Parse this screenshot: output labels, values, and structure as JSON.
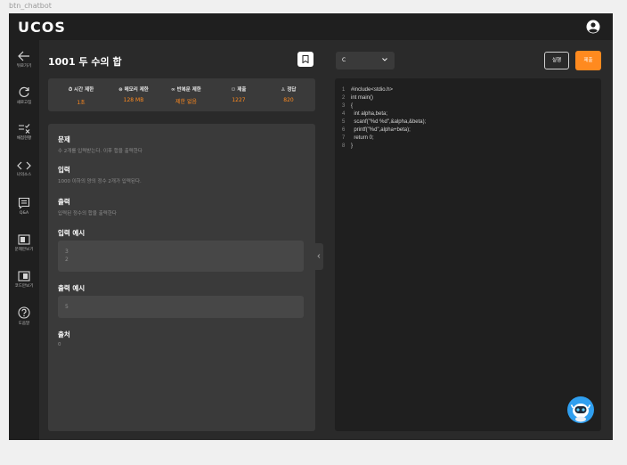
{
  "frame_label": "btn_chatbot",
  "app": {
    "logo": "UCOS"
  },
  "sidebar": {
    "items": [
      {
        "label": "뒤로가기",
        "icon": "arrow-left-icon"
      },
      {
        "label": "새로고침",
        "icon": "refresh-icon"
      },
      {
        "label": "채점현황",
        "icon": "grading-status-icon"
      },
      {
        "label": "나의소스",
        "icon": "code-brackets-icon"
      },
      {
        "label": "Q&A",
        "icon": "qa-icon"
      },
      {
        "label": "문제만보기",
        "icon": "problem-only-icon"
      },
      {
        "label": "코드만보기",
        "icon": "code-only-icon"
      },
      {
        "label": "도움말",
        "icon": "help-icon"
      }
    ]
  },
  "problem": {
    "title": "1001 두 수의 합",
    "stats": [
      {
        "label": "시간 제한",
        "value": "1초",
        "icon": "clock-icon"
      },
      {
        "label": "메모리 제한",
        "value": "128 MB",
        "icon": "memory-icon"
      },
      {
        "label": "반복문 제한",
        "value": "제한 없음",
        "icon": "infinity-icon"
      },
      {
        "label": "제출",
        "value": "1227",
        "icon": "users-icon"
      },
      {
        "label": "정답",
        "value": "820",
        "icon": "user-check-icon"
      }
    ],
    "sections": {
      "problem_head": "문제",
      "problem_text": "수 2개를 입력받는다. 이후 합을 출력한다",
      "input_head": "입력",
      "input_text": "1000 이하의 양의 정수 2개가 입력된다.",
      "output_head": "출력",
      "output_text": "입력된 정수의 합을 출력한다",
      "sample_input_head": "입력 예시",
      "sample_input_lines": [
        "3",
        "2"
      ],
      "sample_output_head": "출력 예시",
      "sample_output_lines": [
        "5"
      ],
      "source_head": "출처",
      "source_text": "0"
    }
  },
  "editor": {
    "language": "C",
    "run_label": "실행",
    "submit_label": "제출",
    "code": [
      {
        "n": "1",
        "text": "#include<stdio.h>"
      },
      {
        "n": "2",
        "text": "int main()"
      },
      {
        "n": "3",
        "text": "{"
      },
      {
        "n": "4",
        "text": "  int alpha,beta;"
      },
      {
        "n": "5",
        "text": "  scanf(\"%d %d\",&alpha,&beta);"
      },
      {
        "n": "6",
        "text": "  printf(\"%d\",alpha+beta);"
      },
      {
        "n": "7",
        "text": "  return 0;"
      },
      {
        "n": "8",
        "text": "}"
      }
    ]
  },
  "colors": {
    "accent": "#ff8a1f",
    "chatbot": "#2f9ff0"
  }
}
